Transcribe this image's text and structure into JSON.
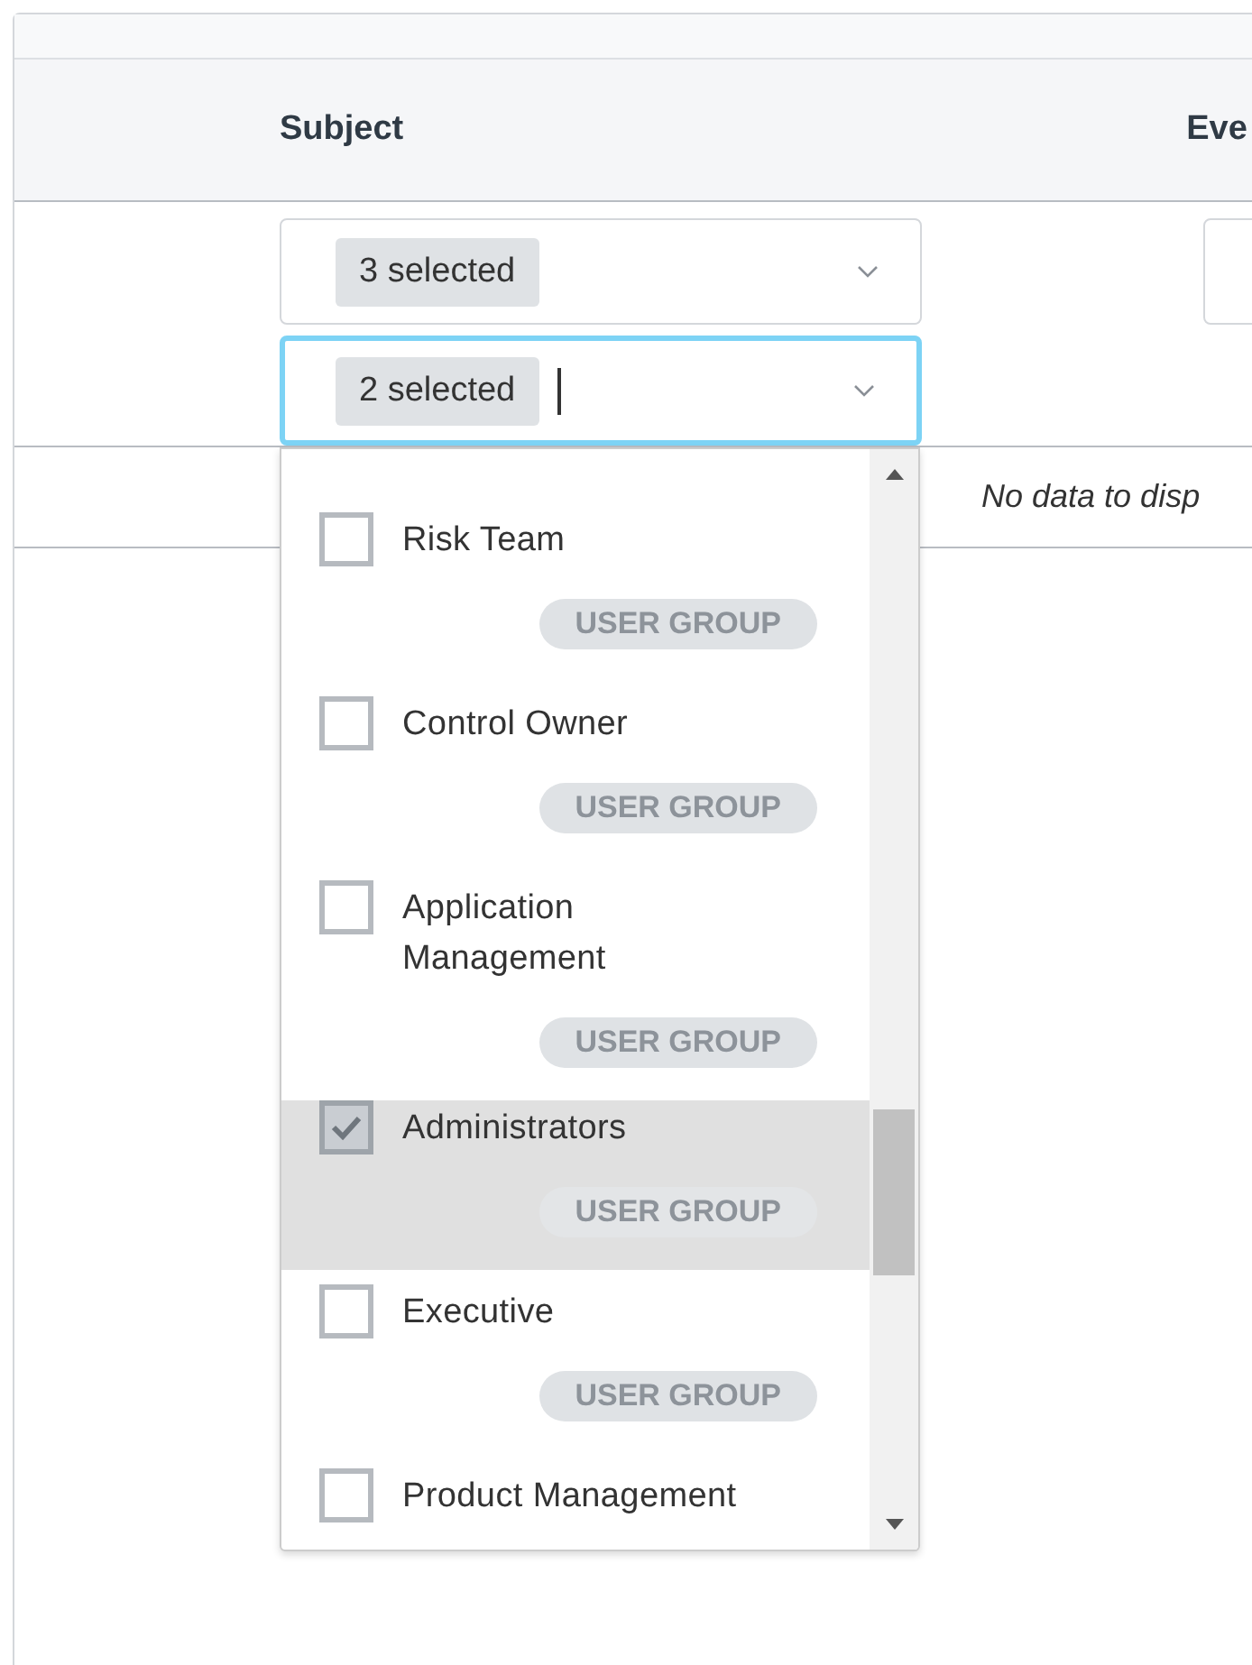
{
  "table": {
    "columns": [
      "Subject",
      "Eve"
    ],
    "filters": [
      {
        "value": "3 selected",
        "focused": false
      },
      {
        "value": "2 selected",
        "focused": true
      }
    ],
    "empty_message": "No data to disp"
  },
  "dropdown": {
    "options": [
      {
        "label": "Risk Team",
        "badge": "USER GROUP",
        "checked": false
      },
      {
        "label": "Control Owner",
        "badge": "USER GROUP",
        "checked": false
      },
      {
        "label": "Application Management",
        "badge": "USER GROUP",
        "checked": false
      },
      {
        "label": "Administrators",
        "badge": "USER GROUP",
        "checked": true
      },
      {
        "label": "Executive",
        "badge": "USER GROUP",
        "checked": false
      },
      {
        "label": "Product Management",
        "checked": false
      }
    ]
  }
}
